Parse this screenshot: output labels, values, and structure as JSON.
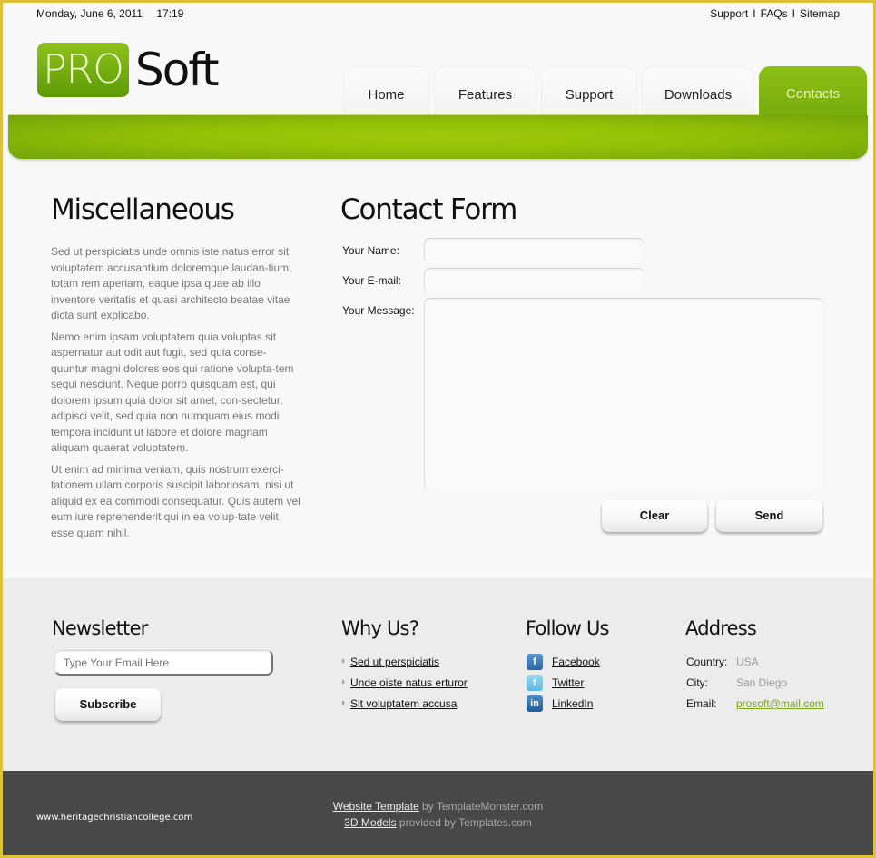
{
  "topbar": {
    "date": "Monday, June 6, 2011",
    "time": "17:19",
    "links": [
      "Support",
      "FAQs",
      "Sitemap"
    ],
    "separator": "I"
  },
  "logo": {
    "badge": "PRO",
    "text": "Soft",
    "badge_color": "#78ad0e"
  },
  "nav": {
    "tabs": [
      {
        "label": "Home",
        "active": false
      },
      {
        "label": "Features",
        "active": false
      },
      {
        "label": "Support",
        "active": false
      },
      {
        "label": "Downloads",
        "active": false
      },
      {
        "label": "Contacts",
        "active": true
      }
    ],
    "accent_color": "#8cbf14"
  },
  "misc": {
    "title": "Miscellaneous",
    "paragraphs": [
      "Sed ut perspiciatis unde omnis iste natus error sit voluptatem accusantium doloremque laudan-tium, totam rem aperiam, eaque ipsa quae ab illo inventore veritatis et quasi architecto beatae vitae dicta sunt explicabo.",
      "Nemo enim ipsam voluptatem quia voluptas sit aspernatur aut odit aut fugit, sed quia conse-quuntur magni dolores eos qui ratione volupta-tem sequi nesciunt. Neque porro quisquam est, qui dolorem ipsum quia dolor sit amet, con-sectetur, adipisci velit, sed quia non numquam eius modi tempora incidunt ut labore et dolore magnam aliquam quaerat voluptatem.",
      "Ut enim ad minima veniam, quis nostrum exerci-tationem ullam corporis suscipit laboriosam, nisi ut aliquid ex ea commodi consequatur. Quis autem vel eum iure reprehenderit qui in ea volup-tate velit esse quam nihil."
    ]
  },
  "contact": {
    "title": "Contact Form",
    "name_label": "Your Name:",
    "name_value": "",
    "email_label": "Your E-mail:",
    "email_value": "",
    "message_label": "Your Message:",
    "message_value": "",
    "clear_label": "Clear",
    "send_label": "Send"
  },
  "newsletter": {
    "title": "Newsletter",
    "placeholder": "Type Your Email Here",
    "value": "",
    "subscribe_label": "Subscribe"
  },
  "why": {
    "title": "Why Us?",
    "items": [
      "Sed ut perspiciatis",
      "Unde oiste natus erturor",
      "Sit voluptatem accusa"
    ]
  },
  "follow": {
    "title": "Follow Us",
    "items": [
      {
        "label": "Facebook",
        "icon": "facebook-icon",
        "glyph": "f",
        "color": "#3a79b8"
      },
      {
        "label": "Twitter",
        "icon": "twitter-icon",
        "glyph": "t",
        "color": "#6cc4ea"
      },
      {
        "label": "LinkedIn",
        "icon": "linkedin-icon",
        "glyph": "in",
        "color": "#2a6ea6"
      }
    ]
  },
  "address": {
    "title": "Address",
    "country_label": "Country:",
    "country": "USA",
    "city_label": "City:",
    "city": "San Diego",
    "email_label": "Email:",
    "email": "prosoft@mail.com",
    "link_color": "#7aa620"
  },
  "bottom": {
    "site": "www.heritagechristiancollege.com",
    "line1_link": "Website Template",
    "line1_rest": " by TemplateMonster.com",
    "line2_link": "3D Models",
    "line2_rest": " provided by Templates.com"
  }
}
